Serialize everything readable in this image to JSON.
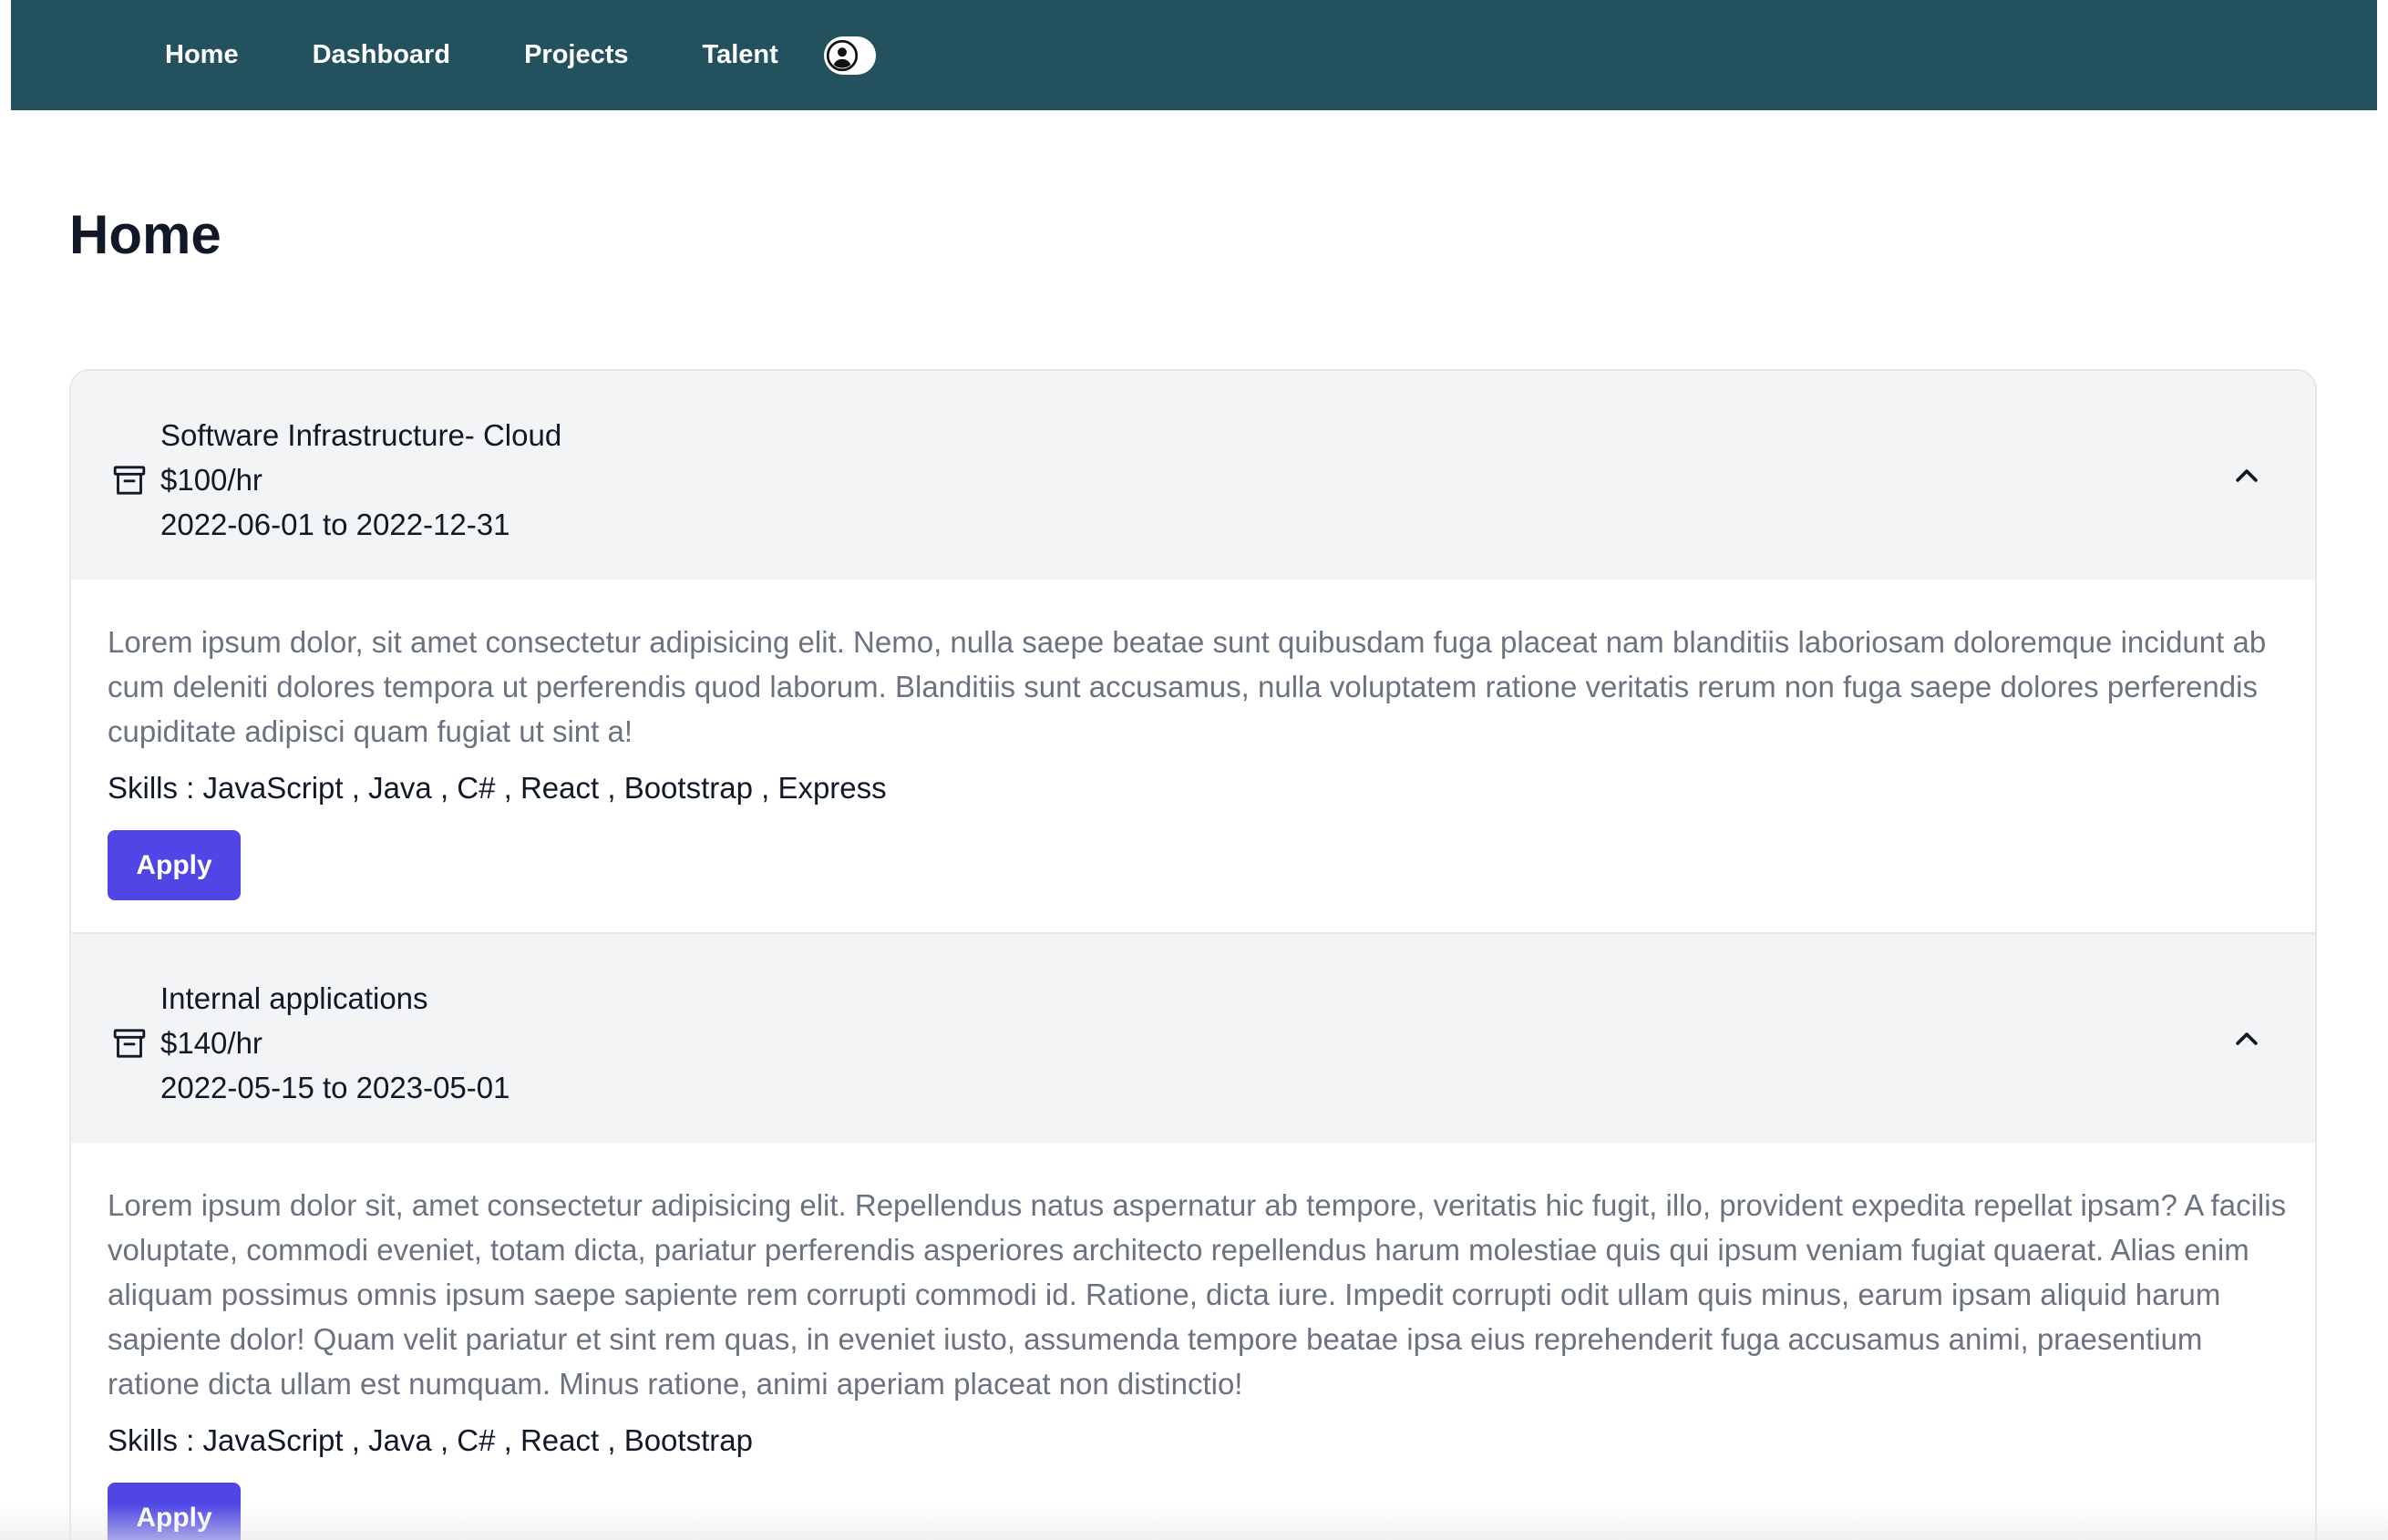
{
  "colors": {
    "navbar_bg": "#23525e",
    "apply_button_bg": "#4f46e5",
    "header_bg": "#f3f4f6",
    "description_text": "#6b7280"
  },
  "nav": {
    "links": [
      "Home",
      "Dashboard",
      "Projects",
      "Talent"
    ],
    "theme_toggle_icon": "user-circle-icon"
  },
  "page": {
    "title": "Home"
  },
  "projects": [
    {
      "icon": "archive-box-icon",
      "name": "Software Infrastructure- Cloud",
      "rate": "$100/hr",
      "dates": "2022-06-01 to 2022-12-31",
      "expanded": true,
      "description": "Lorem ipsum dolor, sit amet consectetur adipisicing elit. Nemo, nulla saepe beatae sunt quibusdam fuga placeat nam blanditiis laboriosam doloremque incidunt ab cum deleniti dolores tempora ut perferendis quod laborum. Blanditiis sunt accusamus, nulla voluptatem ratione veritatis rerum non fuga saepe dolores perferendis cupiditate adipisci quam fugiat ut sint a!",
      "skills": "Skills : JavaScript , Java , C# , React , Bootstrap , Express",
      "apply_label": "Apply"
    },
    {
      "icon": "archive-box-icon",
      "name": "Internal applications",
      "rate": "$140/hr",
      "dates": "2022-05-15 to 2023-05-01",
      "expanded": true,
      "description": "Lorem ipsum dolor sit, amet consectetur adipisicing elit. Repellendus natus aspernatur ab tempore, veritatis hic fugit, illo, provident expedita repellat ipsam? A facilis voluptate, commodi eveniet, totam dicta, pariatur perferendis asperiores architecto repellendus harum molestiae quis qui ipsum veniam fugiat quaerat. Alias enim aliquam possimus omnis ipsum saepe sapiente rem corrupti commodi id. Ratione, dicta iure. Impedit corrupti odit ullam quis minus, earum ipsam aliquid harum sapiente dolor! Quam velit pariatur et sint rem quas, in eveniet iusto, assumenda tempore beatae ipsa eius reprehenderit fuga accusamus animi, praesentium ratione dicta ullam est numquam. Minus ratione, animi aperiam placeat non distinctio!",
      "skills": "Skills : JavaScript , Java , C# , React , Bootstrap",
      "apply_label": "Apply"
    }
  ]
}
